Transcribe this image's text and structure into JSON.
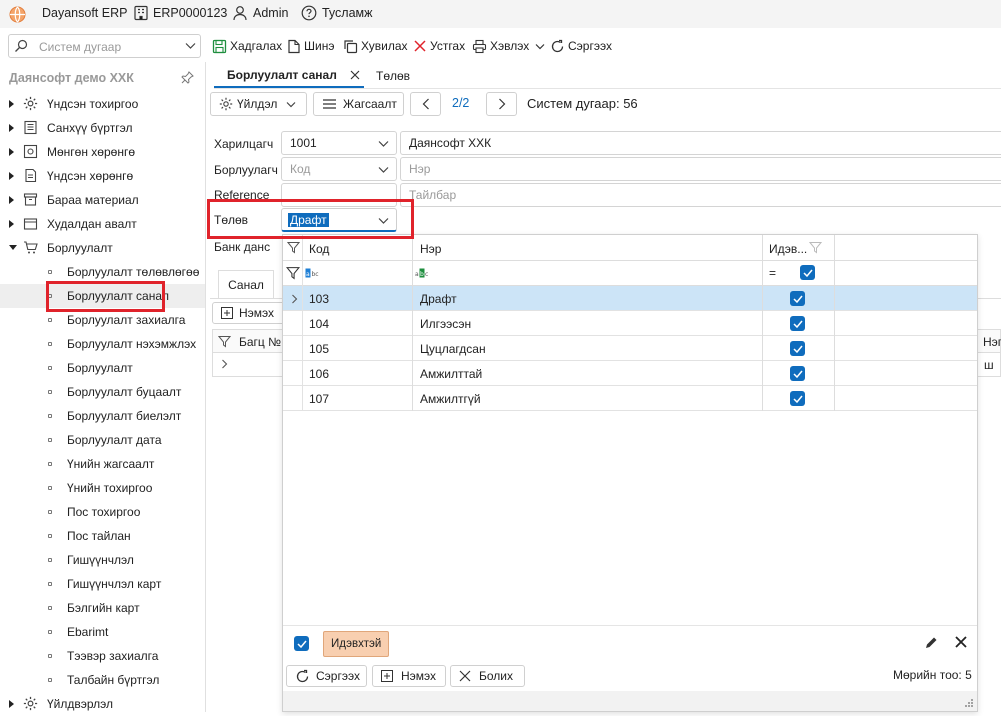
{
  "titlebar": {
    "app_name": "Dayansoft ERP",
    "company_code": "ERP0000123",
    "user": "Admin",
    "help": "Тусламж"
  },
  "toolbar": {
    "search_placeholder": "Систем дугаар",
    "save": "Хадгалах",
    "new": "Шинэ",
    "copy": "Хувилах",
    "delete": "Устгах",
    "print": "Хэвлэх",
    "refresh": "Сэргээх"
  },
  "sidebar": {
    "company": "Даянсофт демо ХХК",
    "items": [
      {
        "label": "Үндсэн тохиргоо",
        "icon": "gear-icon"
      },
      {
        "label": "Санхүү бүртгэл",
        "icon": "ledger-icon"
      },
      {
        "label": "Мөнгөн хөрөнгө",
        "icon": "cash-icon"
      },
      {
        "label": "Үндсэн хөрөнгө",
        "icon": "asset-icon"
      },
      {
        "label": "Бараа материал",
        "icon": "inventory-icon"
      },
      {
        "label": "Худалдан авалт",
        "icon": "purchase-icon"
      },
      {
        "label": "Борлуулалт",
        "icon": "cart-icon"
      }
    ],
    "sub_items": [
      "Борлуулалт төлөвлөгөө",
      "Борлуулалт санал",
      "Борлуулалт захиалга",
      "Борлуулалт нэхэмжлэх",
      "Борлуулалт",
      "Борлуулалт буцаалт",
      "Борлуулалт биелэлт",
      "Борлуулалт дата",
      "Үнийн жагсаалт",
      "Үнийн тохиргоо",
      "Пос тохиргоо",
      "Пос тайлан",
      "Гишүүнчлэл",
      "Гишүүнчлэл карт",
      "Бэлгийн карт",
      "Ebarimt",
      "Тээвэр захиалга",
      "Талбайн бүртгэл"
    ],
    "bottom_item": {
      "label": "Үйлдвэрлэл",
      "icon": "factory-icon"
    }
  },
  "tabs": [
    {
      "label": "Борлуулалт санал",
      "active": true
    },
    {
      "label": "Төлөв",
      "active": false
    }
  ],
  "actionbar": {
    "actions": "Үйлдэл",
    "list": "Жагсаалт",
    "pager": "2/2",
    "sysno": "Систем дугаар: 56"
  },
  "form": {
    "customer_label": "Харилцагч",
    "customer_code": "1001",
    "customer_name": "Даянсофт ХХК",
    "seller_label": "Борлуулагч",
    "seller_code_ph": "Код",
    "seller_name_ph": "Нэр",
    "reference_label": "Reference",
    "description_ph": "Тайлбар",
    "status_label": "Төлөв",
    "status_value": "Драфт",
    "bank_label": "Банк данс"
  },
  "subtabs": {
    "offer": "Санал",
    "add_short": "Нэмэх",
    "bag_col": "Багц №",
    "right_col": "Нэг",
    "right_cell": "ш"
  },
  "popup": {
    "columns": {
      "code": "Код",
      "name": "Нэр",
      "active": "Идэв..."
    },
    "filter_eq": "=",
    "rows": [
      {
        "code": "103",
        "name": "Драфт",
        "active": true
      },
      {
        "code": "104",
        "name": "Илгээсэн",
        "active": true
      },
      {
        "code": "105",
        "name": "Цуцлагдсан",
        "active": true
      },
      {
        "code": "106",
        "name": "Амжилттай",
        "active": true
      },
      {
        "code": "107",
        "name": "Амжилтгүй",
        "active": true
      }
    ],
    "filter_tag": "Идэвхтэй",
    "refresh": "Сэргээх",
    "add": "Нэмэх",
    "cancel": "Болих",
    "count": "Мөрийн тоо: 5"
  },
  "colors": {
    "accent": "#0f6cbd",
    "selected_row": "#cce4f7",
    "highlight": "#e0232b",
    "tag_bg": "#f8cfb0"
  }
}
